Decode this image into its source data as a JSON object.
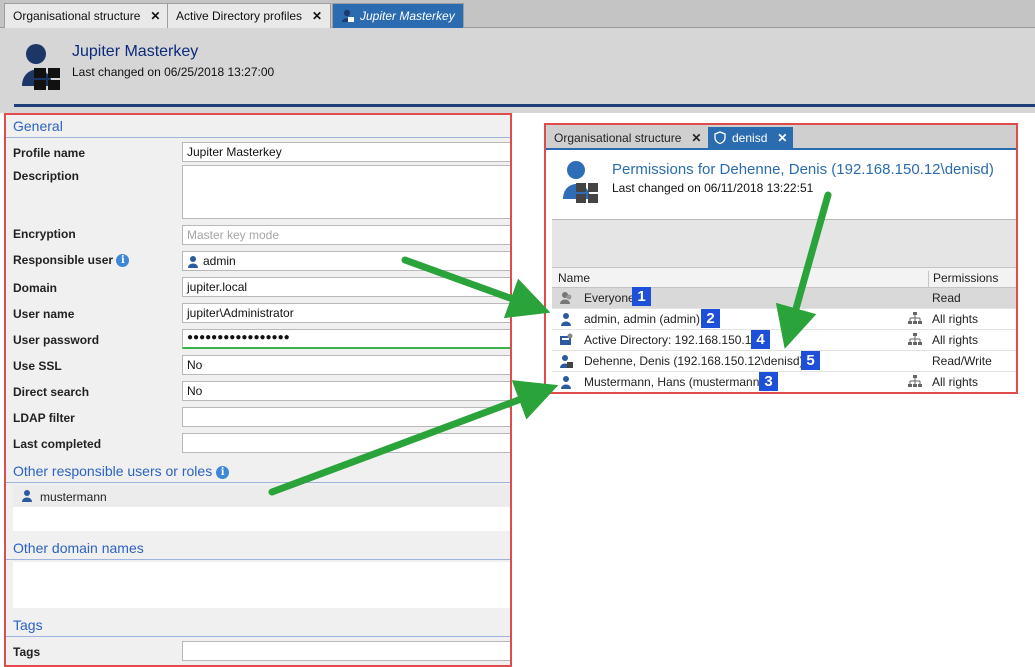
{
  "top_window": {
    "tabs": [
      {
        "label": "Organisational structure"
      },
      {
        "label": "Active Directory profiles"
      },
      {
        "label": "Jupiter Masterkey"
      }
    ],
    "title": "Jupiter Masterkey",
    "last_changed": "Last changed on 06/25/2018 13:27:00"
  },
  "form": {
    "general_heading": "General",
    "fields": [
      {
        "label": "Profile name",
        "value": "Jupiter Masterkey"
      },
      {
        "label": "Description",
        "value": ""
      },
      {
        "label": "Encryption",
        "value": "",
        "placeholder": "Master key mode"
      },
      {
        "label": "Responsible user",
        "value": "admin"
      },
      {
        "label": "Domain",
        "value": "jupiter.local"
      },
      {
        "label": "User name",
        "value": "jupiter\\Administrator"
      },
      {
        "label": "User password",
        "value": "●●●●●●●●●●●●●●●●●"
      },
      {
        "label": "Use SSL",
        "value": "No"
      },
      {
        "label": "Direct search",
        "value": "No"
      },
      {
        "label": "LDAP filter",
        "value": ""
      },
      {
        "label": "Last completed",
        "value": ""
      }
    ],
    "other_users_heading": "Other responsible users or roles",
    "other_users": [
      "mustermann"
    ],
    "other_domains_heading": "Other domain names",
    "tags_heading": "Tags",
    "tags_label": "Tags"
  },
  "permissions_window": {
    "tabs": [
      {
        "label": "Organisational structure"
      },
      {
        "label": "denisd"
      }
    ],
    "title": "Permissions for Dehenne, Denis (192.168.150.12\\denisd)",
    "last_changed": "Last changed on 06/11/2018 13:22:51",
    "columns": {
      "name": "Name",
      "permissions": "Permissions"
    },
    "rows": [
      {
        "name": "Everyone",
        "permission": "Read",
        "badge": "1",
        "icon": "role-icon"
      },
      {
        "name": "admin, admin (admin)",
        "permission": "All rights",
        "badge": "2",
        "icon": "user-icon"
      },
      {
        "name": "Active Directory: 192.168.150.12",
        "permission": "All rights",
        "badge": "4",
        "icon": "directory-icon"
      },
      {
        "name": "Dehenne, Denis (192.168.150.12\\denisd)",
        "permission": "Read/Write",
        "badge": "5",
        "icon": "user-icon"
      },
      {
        "name": "Mustermann, Hans (mustermann)",
        "permission": "All rights",
        "badge": "3",
        "icon": "user-icon"
      }
    ]
  },
  "colors": {
    "accent": "#2b6cb0",
    "highlight_border": "#e04b4b",
    "arrow": "#2aa33a",
    "badge": "#1d4fd8"
  }
}
